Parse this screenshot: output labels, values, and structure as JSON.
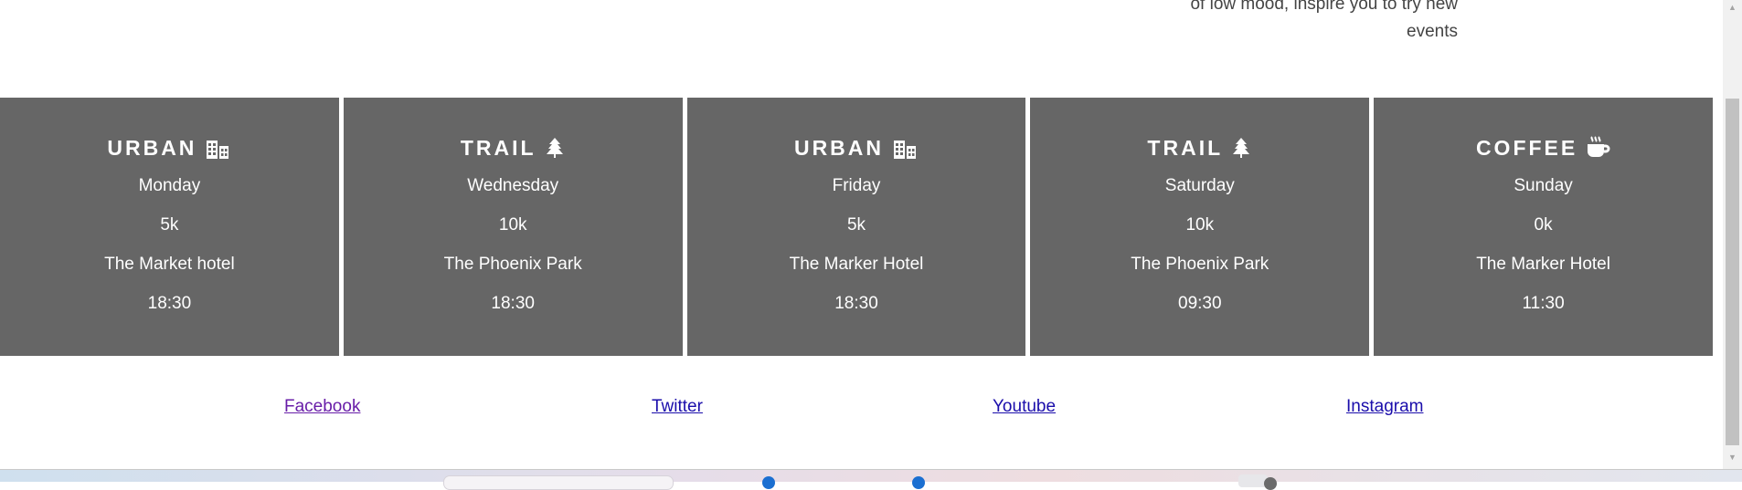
{
  "intro": {
    "line1": "of low mood, inspire you to try new",
    "line2": "events"
  },
  "schedule": [
    {
      "title": "URBAN",
      "icon": "city-icon",
      "day": "Monday",
      "distance": "5k",
      "location": "The Market hotel",
      "time": "18:30"
    },
    {
      "title": "TRAIL",
      "icon": "tree-icon",
      "day": "Wednesday",
      "distance": "10k",
      "location": "The Phoenix Park",
      "time": "18:30"
    },
    {
      "title": "URBAN",
      "icon": "city-icon",
      "day": "Friday",
      "distance": "5k",
      "location": "The Marker Hotel",
      "time": "18:30"
    },
    {
      "title": "TRAIL",
      "icon": "tree-icon",
      "day": "Saturday",
      "distance": "10k",
      "location": "The Phoenix Park",
      "time": "09:30"
    },
    {
      "title": "COFFEE",
      "icon": "coffee-icon",
      "day": "Sunday",
      "distance": "0k",
      "location": "The Marker Hotel",
      "time": "11:30"
    }
  ],
  "footer": {
    "links": [
      "Facebook",
      "Twitter",
      "Youtube",
      "Instagram"
    ]
  },
  "colors": {
    "card_bg": "#666666",
    "card_text": "#ffffff",
    "link": "#1a0dab",
    "link_visited": "#681da8"
  }
}
